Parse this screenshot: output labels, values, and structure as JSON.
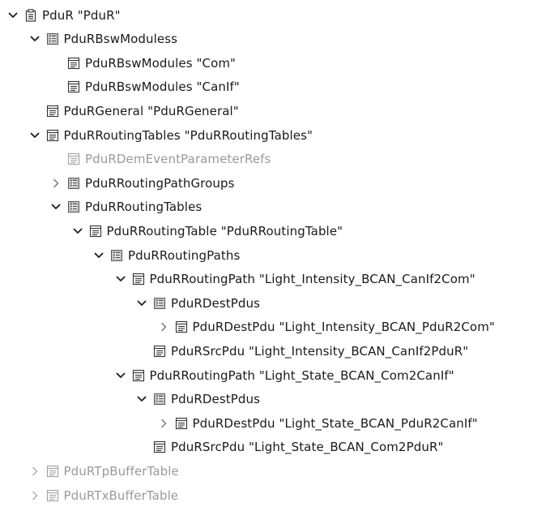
{
  "tree": {
    "nodes": [
      {
        "label": "PduR \"PduR\"",
        "depth": 0,
        "toggle": "expanded",
        "icon": "module-icon",
        "disabled": false
      },
      {
        "label": "PduRBswModuless",
        "depth": 1,
        "toggle": "expanded",
        "icon": "container-list-icon",
        "disabled": false
      },
      {
        "label": "PduRBswModules \"Com\"",
        "depth": 2,
        "toggle": "none",
        "icon": "container-icon",
        "disabled": false
      },
      {
        "label": "PduRBswModules \"CanIf\"",
        "depth": 2,
        "toggle": "none",
        "icon": "container-icon",
        "disabled": false
      },
      {
        "label": "PduRGeneral \"PduRGeneral\"",
        "depth": 1,
        "toggle": "none",
        "icon": "container-icon",
        "disabled": false
      },
      {
        "label": "PduRRoutingTables \"PduRRoutingTables\"",
        "depth": 1,
        "toggle": "expanded",
        "icon": "container-icon",
        "disabled": false
      },
      {
        "label": "PduRDemEventParameterRefs",
        "depth": 2,
        "toggle": "none",
        "icon": "container-icon",
        "disabled": true
      },
      {
        "label": "PduRRoutingPathGroups",
        "depth": 2,
        "toggle": "collapsed",
        "icon": "container-list-icon",
        "disabled": false
      },
      {
        "label": "PduRRoutingTables",
        "depth": 2,
        "toggle": "expanded",
        "icon": "container-list-icon",
        "disabled": false
      },
      {
        "label": "PduRRoutingTable \"PduRRoutingTable\"",
        "depth": 3,
        "toggle": "expanded",
        "icon": "container-icon",
        "disabled": false
      },
      {
        "label": "PduRRoutingPaths",
        "depth": 4,
        "toggle": "expanded",
        "icon": "container-list-icon",
        "disabled": false
      },
      {
        "label": "PduRRoutingPath \"Light_Intensity_BCAN_CanIf2Com\"",
        "depth": 5,
        "toggle": "expanded",
        "icon": "container-icon",
        "disabled": false
      },
      {
        "label": "PduRDestPdus",
        "depth": 6,
        "toggle": "expanded",
        "icon": "container-list-icon",
        "disabled": false
      },
      {
        "label": "PduRDestPdu \"Light_Intensity_BCAN_PduR2Com\"",
        "depth": 7,
        "toggle": "collapsed",
        "icon": "container-icon",
        "disabled": false
      },
      {
        "label": "PduRSrcPdu \"Light_Intensity_BCAN_CanIf2PduR\"",
        "depth": 6,
        "toggle": "none",
        "icon": "container-icon",
        "disabled": false
      },
      {
        "label": "PduRRoutingPath \"Light_State_BCAN_Com2CanIf\"",
        "depth": 5,
        "toggle": "expanded",
        "icon": "container-icon",
        "disabled": false
      },
      {
        "label": "PduRDestPdus",
        "depth": 6,
        "toggle": "expanded",
        "icon": "container-list-icon",
        "disabled": false
      },
      {
        "label": "PduRDestPdu \"Light_State_BCAN_PduR2CanIf\"",
        "depth": 7,
        "toggle": "collapsed",
        "icon": "container-icon",
        "disabled": false
      },
      {
        "label": "PduRSrcPdu \"Light_State_BCAN_Com2PduR\"",
        "depth": 6,
        "toggle": "none",
        "icon": "container-icon",
        "disabled": false
      },
      {
        "label": "PduRTpBufferTable",
        "depth": 1,
        "toggle": "collapsed",
        "icon": "container-icon",
        "disabled": true
      },
      {
        "label": "PduRTxBufferTable",
        "depth": 1,
        "toggle": "collapsed",
        "icon": "container-icon",
        "disabled": true
      }
    ]
  }
}
